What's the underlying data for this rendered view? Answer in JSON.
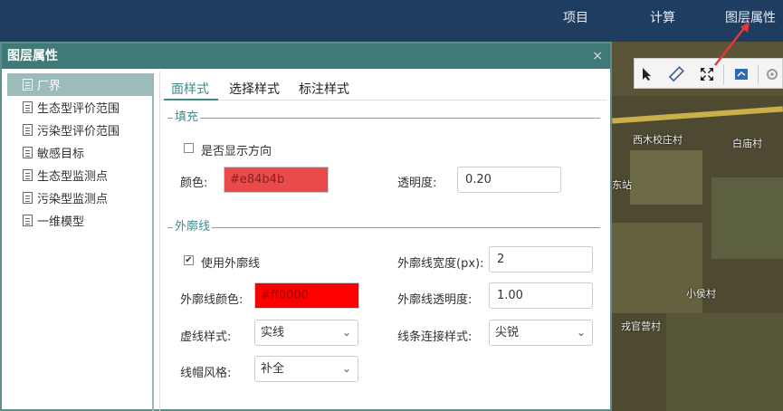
{
  "topnav": {
    "project": "项目",
    "compute": "计算",
    "layer_props": "图层属性"
  },
  "dialog": {
    "title": "图层属性",
    "close": "×",
    "layers": [
      {
        "label": "厂界",
        "active": true
      },
      {
        "label": "生态型评价范围"
      },
      {
        "label": "污染型评价范围"
      },
      {
        "label": "敏感目标"
      },
      {
        "label": "生态型监测点"
      },
      {
        "label": "污染型监测点"
      },
      {
        "label": "一维模型"
      }
    ],
    "tabs": {
      "face": "面样式",
      "select": "选择样式",
      "label": "标注样式"
    },
    "fill": {
      "section": "填充",
      "show_direction_label": "是否显示方向",
      "show_direction_checked": false,
      "color_label": "颜色:",
      "color_value": "#e84b4b",
      "opacity_label": "透明度:",
      "opacity_value": "0.20"
    },
    "outline": {
      "section": "外廓线",
      "use_outline_label": "使用外廓线",
      "use_outline_checked": true,
      "width_label": "外廓线宽度(px):",
      "width_value": "2",
      "color_label": "外廓线颜色:",
      "color_value": "#ff0000",
      "opacity_label": "外廓线透明度:",
      "opacity_value": "1.00",
      "dash_label": "虚线样式:",
      "dash_value": "实线",
      "join_label": "线条连接样式:",
      "join_value": "尖锐",
      "cap_label": "线帽风格:",
      "cap_value": "补全"
    }
  },
  "map": {
    "labels": [
      "西木校庄村",
      "白庙村",
      "东站",
      "小侯村",
      "戎官营村"
    ]
  },
  "colors": {
    "header": "#3f7a77",
    "accent": "#3d8c88",
    "topbar": "#1f3d60",
    "arrow": "#e53935"
  }
}
